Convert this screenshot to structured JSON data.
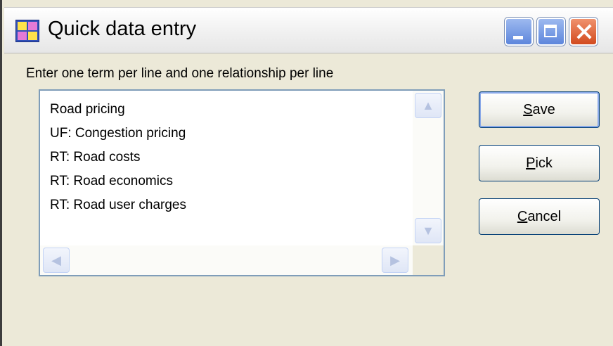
{
  "window": {
    "title": "Quick data entry",
    "icon": "thesaurus-app-icon",
    "controls": [
      "minimize-icon",
      "maximize-icon",
      "close-icon"
    ]
  },
  "instruction": "Enter one term per line and one relationship per line",
  "editor": {
    "lines": [
      "Road pricing",
      "UF: Congestion pricing",
      "RT: Road costs",
      "RT: Road economics",
      "RT: Road user charges"
    ],
    "scroll_icons": [
      "scroll-up-icon",
      "scroll-down-icon",
      "scroll-left-icon",
      "scroll-right-icon"
    ]
  },
  "buttons": {
    "save": {
      "mnemonic": "S",
      "rest": "ave"
    },
    "pick": {
      "mnemonic": "P",
      "rest": "ick"
    },
    "cancel": {
      "mnemonic": "C",
      "rest": "ancel"
    }
  },
  "colors": {
    "dialog_bg": "#ece9d8",
    "button_border": "#003c74",
    "close_button": "#d24a1e",
    "window_control": "#5d86dc"
  }
}
